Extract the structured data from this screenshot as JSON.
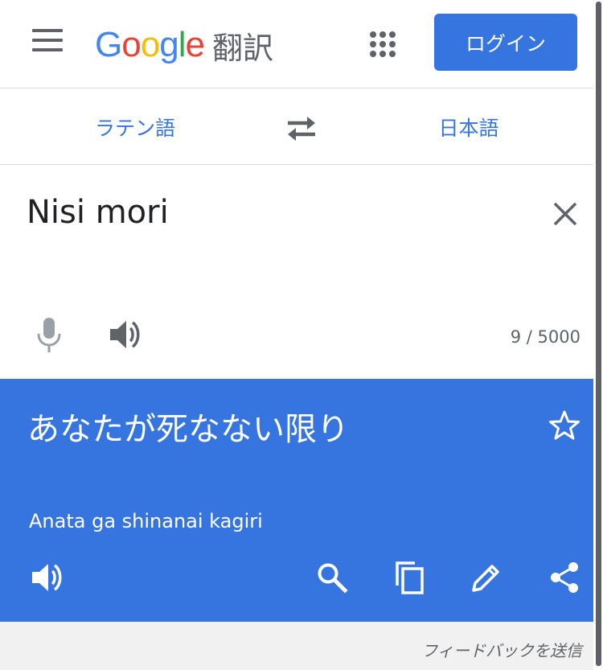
{
  "header": {
    "logo_letters": [
      {
        "ch": "G",
        "color": "#4285F4"
      },
      {
        "ch": "o",
        "color": "#EA4335"
      },
      {
        "ch": "o",
        "color": "#FBBC05"
      },
      {
        "ch": "g",
        "color": "#4285F4"
      },
      {
        "ch": "l",
        "color": "#34A853"
      },
      {
        "ch": "e",
        "color": "#EA4335"
      }
    ],
    "logo_text": "Google",
    "product_name": "翻訳",
    "login_label": "ログイン",
    "icons": {
      "menu": "hamburger-menu-icon",
      "apps": "apps-grid-icon"
    }
  },
  "languages": {
    "source": "ラテン語",
    "target": "日本語",
    "swap_icon": "swap-arrows-icon"
  },
  "input": {
    "text": "Nisi mori",
    "char_count": "9 / 5000",
    "icons": {
      "clear": "close-icon",
      "mic": "microphone-icon",
      "speak": "speaker-icon"
    }
  },
  "result": {
    "text": "あなたが死なない限り",
    "romanization": "Anata ga shinanai kagiri",
    "icons": {
      "star": "star-outline-icon",
      "speak": "speaker-icon",
      "search": "search-icon",
      "copy": "copy-icon",
      "edit": "edit-pencil-icon",
      "share": "share-icon"
    }
  },
  "footer": {
    "feedback": "フィードバックを送信"
  },
  "colors": {
    "accent": "#3674E0",
    "text_dark": "#202124",
    "icon_gray": "#5F6368",
    "mic_disabled": "#9AA0A6",
    "footer_bg": "#F1F1F1"
  }
}
